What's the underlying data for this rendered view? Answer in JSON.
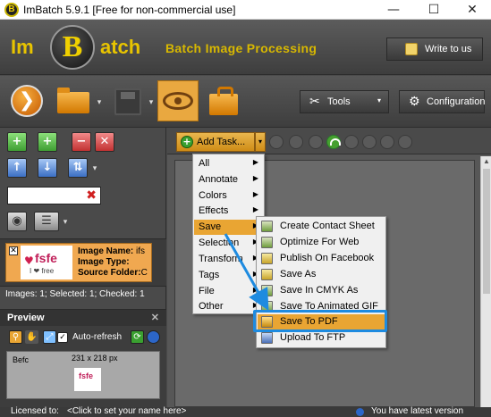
{
  "window": {
    "title": "ImBatch 5.9.1 [Free for non-commercial use]",
    "app_icon_letter": "B",
    "minimize_glyph": "—",
    "maximize_glyph": "☐",
    "close_glyph": "✕"
  },
  "banner": {
    "logo_left": "Im",
    "logo_center": "B",
    "logo_right": "atch",
    "tagline": "Batch Image Processing",
    "write_to_us": "Write to us"
  },
  "toolbar": {
    "run_glyph": "❯",
    "tools_label": "Tools",
    "tools_icon": "wrench-icon",
    "configuration_label": "Configuration",
    "configuration_icon": "gear-icon",
    "dropdown_glyph": "▾"
  },
  "left_panel": {
    "search_value": "",
    "clear_glyph": "✖",
    "file_item": {
      "checked_glyph": "✕",
      "thumb_text": "fsfe",
      "thumb_sub": "I ❤ free",
      "image_name_label": "Image Name:",
      "image_name_value": "ifs",
      "image_type_label": "Image Type:",
      "image_type_value": "",
      "source_folder_label": "Source Folder:",
      "source_folder_value": "C"
    },
    "status": "Images: 1; Selected: 1; Checked: 1"
  },
  "preview": {
    "title": "Preview",
    "close_glyph": "✕",
    "auto_refresh": "Auto-refresh",
    "before_label": "Befc",
    "dimensions": "231 x 218 px",
    "thumb_text": "fsfe"
  },
  "tasks": {
    "add_task": "Add Task...",
    "add_glyph": "+"
  },
  "menu_level1": [
    {
      "label": "All",
      "has_sub": true,
      "active": false
    },
    {
      "label": "Annotate",
      "has_sub": true,
      "active": false
    },
    {
      "label": "Colors",
      "has_sub": true,
      "active": false
    },
    {
      "label": "Effects",
      "has_sub": true,
      "active": false
    },
    {
      "label": "Save",
      "has_sub": true,
      "active": true
    },
    {
      "label": "Selection",
      "has_sub": true,
      "active": false
    },
    {
      "label": "Transform",
      "has_sub": true,
      "active": false
    },
    {
      "label": "Tags",
      "has_sub": true,
      "active": false
    },
    {
      "label": "File",
      "has_sub": true,
      "active": false
    },
    {
      "label": "Other",
      "has_sub": true,
      "active": false
    }
  ],
  "menu_save": [
    {
      "label": "Create Contact Sheet",
      "icon": "contact-sheet-icon",
      "active": false
    },
    {
      "label": "Optimize For Web",
      "icon": "web-optimize-icon",
      "active": false
    },
    {
      "label": "Publish On Facebook",
      "icon": "facebook-icon",
      "active": false
    },
    {
      "label": "Save As",
      "icon": "save-as-icon",
      "active": false
    },
    {
      "label": "Save In CMYK As",
      "icon": "cmyk-icon",
      "active": false
    },
    {
      "label": "Save To Animated GIF",
      "icon": "gif-icon",
      "active": false
    },
    {
      "label": "Save To PDF",
      "icon": "pdf-icon",
      "active": true
    },
    {
      "label": "Upload To FTP",
      "icon": "ftp-icon",
      "active": false
    }
  ],
  "statusbar": {
    "licensed_to": "Licensed to:",
    "licensee": "<Click to set your name here>",
    "version_status": "You have latest version"
  },
  "colors": {
    "accent_orange": "#e9a533",
    "highlight_blue": "#1e8be0",
    "logo_yellow": "#e8c400"
  }
}
